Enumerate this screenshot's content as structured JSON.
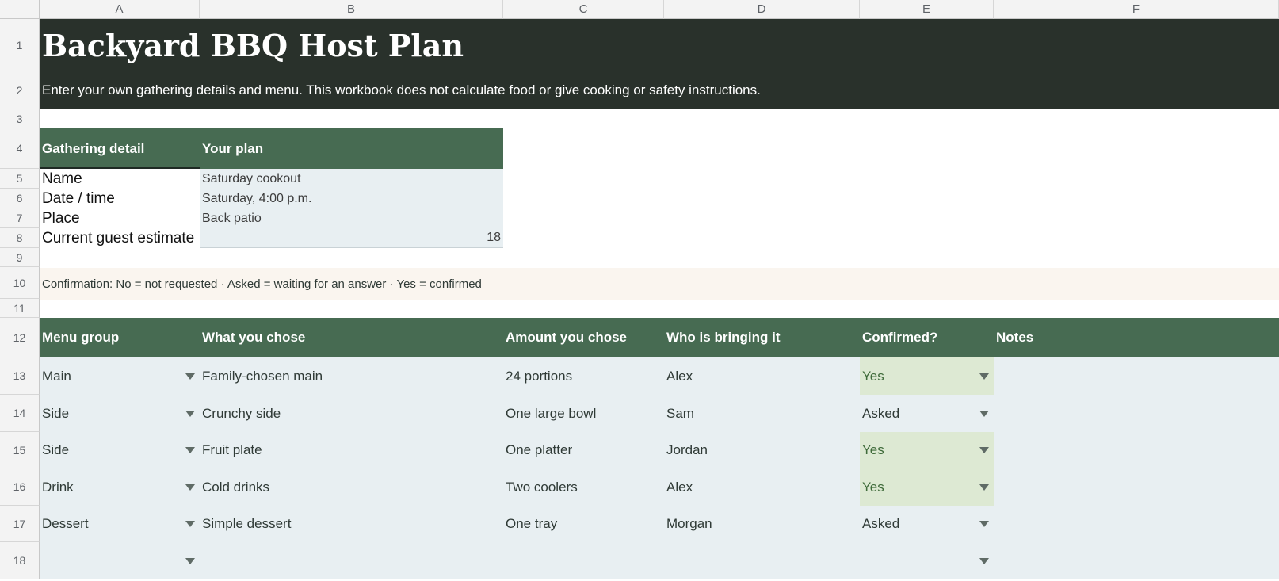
{
  "columns": [
    "A",
    "B",
    "C",
    "D",
    "E",
    "F"
  ],
  "rows": [
    "1",
    "2",
    "3",
    "4",
    "5",
    "6",
    "7",
    "8",
    "9",
    "10",
    "11",
    "12",
    "13",
    "14",
    "15",
    "16",
    "17",
    "18"
  ],
  "title": "Backyard BBQ Host Plan",
  "subtitle": "Enter your own gathering details and menu. This workbook does not calculate food or give cooking or safety instructions.",
  "details": {
    "header": [
      "Gathering detail",
      "Your plan"
    ],
    "items": [
      {
        "label": "Name",
        "value": "Saturday cookout"
      },
      {
        "label": "Date / time",
        "value": "Saturday, 4:00 p.m."
      },
      {
        "label": "Place",
        "value": "Back patio"
      },
      {
        "label": "Current guest estimate",
        "value": "18"
      }
    ]
  },
  "legend": "Confirmation: No = not requested · Asked = waiting for an answer · Yes = confirmed",
  "menu": {
    "headers": [
      "Menu group",
      "What you chose",
      "Amount you chose",
      "Who is bringing it",
      "Confirmed?",
      "Notes"
    ],
    "rows": [
      {
        "group": "Main",
        "chose": "Family-chosen main",
        "amount": "24 portions",
        "who": "Alex",
        "confirmed": "Yes",
        "notes": ""
      },
      {
        "group": "Side",
        "chose": "Crunchy side",
        "amount": "One large bowl",
        "who": "Sam",
        "confirmed": "Asked",
        "notes": ""
      },
      {
        "group": "Side",
        "chose": "Fruit plate",
        "amount": "One platter",
        "who": "Jordan",
        "confirmed": "Yes",
        "notes": ""
      },
      {
        "group": "Drink",
        "chose": "Cold drinks",
        "amount": "Two coolers",
        "who": "Alex",
        "confirmed": "Yes",
        "notes": ""
      },
      {
        "group": "Dessert",
        "chose": "Simple dessert",
        "amount": "One tray",
        "who": "Morgan",
        "confirmed": "Asked",
        "notes": ""
      },
      {
        "group": "",
        "chose": "",
        "amount": "",
        "who": "",
        "confirmed": "",
        "notes": ""
      }
    ]
  },
  "colors": {
    "title_band": "#29312b",
    "header_green": "#476b52",
    "input_fill": "#e8eff2",
    "legend_fill": "#faf5ef",
    "confirmed_yes_fill": "#dde9d3",
    "confirmed_yes_text": "#3f6b3a"
  }
}
